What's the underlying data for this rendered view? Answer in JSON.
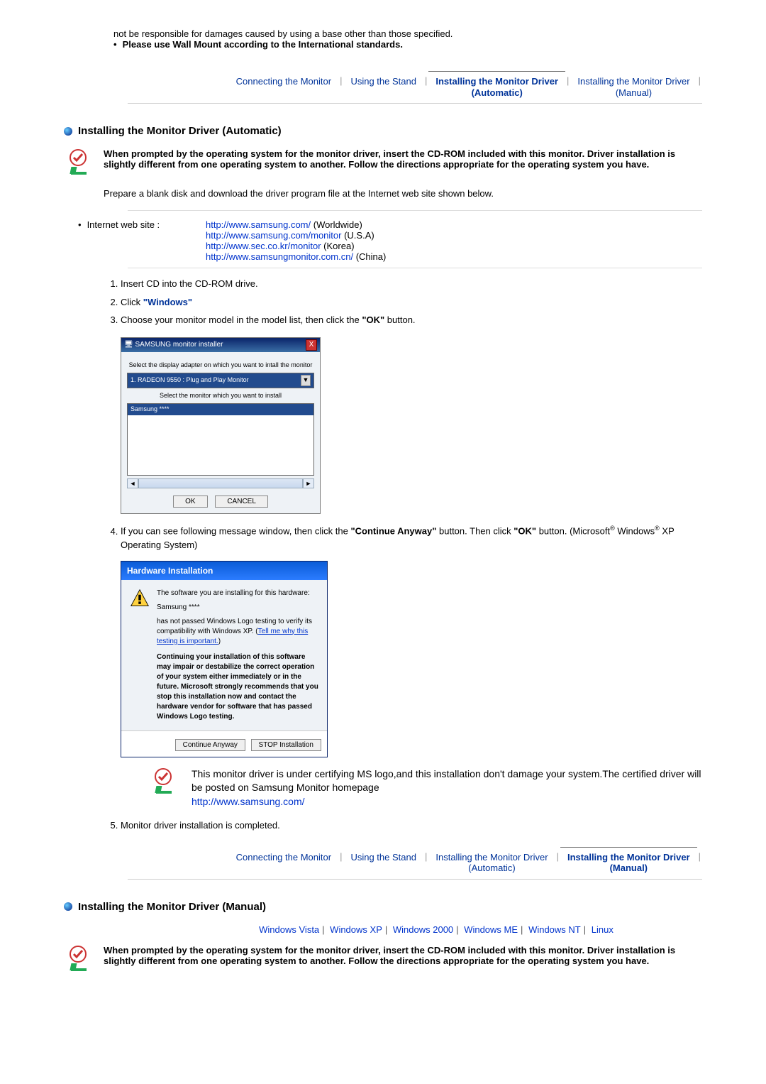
{
  "top": {
    "line1": "not be responsible for damages caused by using a base other than those specified.",
    "line2": "Please use Wall Mount according to the International standards."
  },
  "nav": {
    "t1": "Connecting the Monitor",
    "t2": "Using the Stand",
    "t3": "Installing the Monitor Driver\n(Automatic)",
    "t4": "Installing the Monitor Driver\n(Manual)"
  },
  "sectionA": {
    "title": "Installing the Monitor Driver (Automatic)",
    "note": "When prompted by the operating system for the monitor driver, insert the CD-ROM included with this monitor. Driver installation is slightly different from one operating system to another. Follow the directions appropriate for the operating system you have.",
    "prep": "Prepare a blank disk and download the driver program file at the Internet web site shown below.",
    "web_label": "Internet web site :",
    "sites": [
      {
        "url": "http://www.samsung.com/",
        "loc": " (Worldwide)"
      },
      {
        "url": "http://www.samsung.com/monitor",
        "loc": " (U.S.A)"
      },
      {
        "url": "http://www.sec.co.kr/monitor",
        "loc": " (Korea)"
      },
      {
        "url": "http://www.samsungmonitor.com.cn/",
        "loc": " (China)"
      }
    ],
    "steps": {
      "s1": "Insert CD into the CD-ROM drive.",
      "s2a": "Click ",
      "s2b": "\"Windows\"",
      "s3a": "Choose your monitor model in the model list, then click the ",
      "s3b": "\"OK\"",
      "s3c": " button.",
      "s4a": "If you can see following message window, then click the ",
      "s4b": "\"Continue Anyway\"",
      "s4c": " button. Then click ",
      "s4d": "\"OK\"",
      "s4e": " button. (Microsoft",
      "s4f": " Windows",
      "s4g": " XP Operating System)",
      "s5": "Monitor driver installation is completed."
    }
  },
  "dlg1": {
    "title": "SAMSUNG monitor installer",
    "x": "X",
    "lbl1": "Select the display adapter on which you want to intall the monitor",
    "sel": "1. RADEON 9550 : Plug and Play Monitor",
    "lbl2": "Select the monitor which you want to install",
    "item": "Samsung ****",
    "ok": "OK",
    "cancel": "CANCEL"
  },
  "dlg2": {
    "title": "Hardware Installation",
    "line1": "The software you are installing for this hardware:",
    "prod": "Samsung ****",
    "line2a": "has not passed Windows Logo testing to verify its compatibility with Windows XP. (",
    "tell": "Tell me why this testing is important.",
    "line2b": ")",
    "line3": "Continuing your installation of this software may impair or destabilize the correct operation of your system either immediately or in the future. Microsoft strongly recommends that you stop this installation now and contact the hardware vendor for software that has passed Windows Logo testing.",
    "btn1": "Continue Anyway",
    "btn2": "STOP Installation"
  },
  "cert": {
    "text": "This monitor driver is under certifying MS logo,and this installation don't damage your system.The certified driver will be posted on Samsung Monitor homepage",
    "url": "http://www.samsung.com/"
  },
  "sectionB": {
    "title": "Installing the Monitor Driver (Manual)",
    "os": [
      "Windows Vista",
      "Windows XP",
      "Windows 2000",
      "Windows ME",
      "Windows NT",
      "Linux"
    ],
    "note": "When prompted by the operating system for the monitor driver, insert the CD-ROM included with this monitor. Driver installation is slightly different from one operating system to another. Follow the directions appropriate for the operating system you have."
  }
}
